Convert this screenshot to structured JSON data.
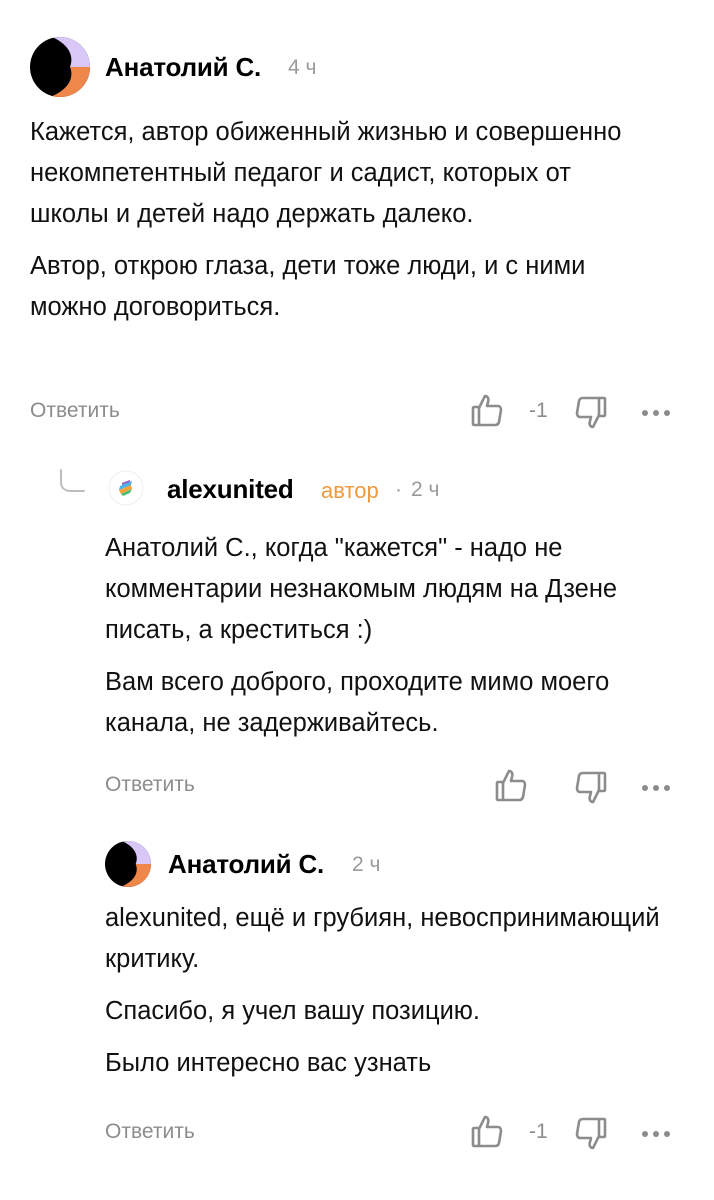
{
  "comments": [
    {
      "author": "Анатолий С.",
      "time": "4 ч",
      "paragraphs": [
        "Кажется, автор обиженный жизнью и совершенно некомпетентный педагог и садист, которых от школы и детей надо держать далеко.",
        "Автор, открою глаза, дети тоже люди, и с ними можно договориться."
      ],
      "reply_label": "Ответить",
      "score": "-1"
    },
    {
      "author": "alexunited",
      "badge": "автор",
      "separator": "·",
      "time": "2 ч",
      "paragraphs": [
        "Анатолий С., когда \"кажется\" - надо не комментарии незнакомым людям на Дзене писать, а креститься :)",
        "Вам всего доброго, проходите мимо моего канала, не задерживайтесь."
      ],
      "reply_label": "Ответить",
      "score": ""
    },
    {
      "author": "Анатолий С.",
      "time": "2 ч",
      "paragraphs": [
        "alexunited, ещё и грубиян, невоспринимающий критику.",
        "Спасибо, я учел вашу позицию.",
        "Было интересно вас узнать"
      ],
      "reply_label": "Ответить",
      "score": "-1"
    }
  ],
  "colors": {
    "avatar_black": "#000000",
    "avatar_lilac": "#d9c7f7",
    "avatar_orange": "#f0874a",
    "badge": "#f09a3e",
    "muted": "#8c8c8c"
  },
  "icons": [
    "like-icon",
    "dislike-icon",
    "more-icon",
    "thread-line-icon"
  ]
}
